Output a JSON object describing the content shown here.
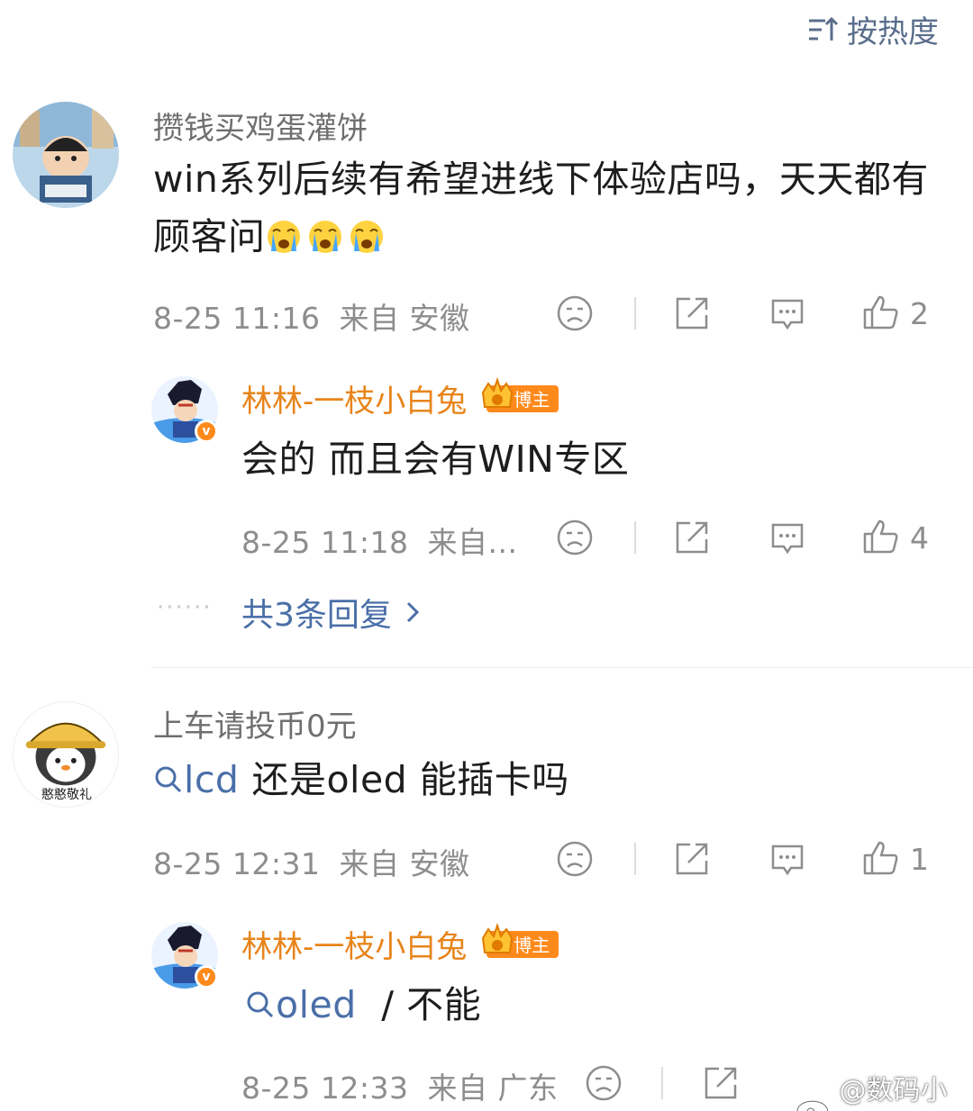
{
  "sort": {
    "label": "按热度",
    "icon": "sort-icon"
  },
  "comments": [
    {
      "username": "攒钱买鸡蛋灌饼",
      "content": "win系列后续有希望进线下体验店吗，天天都有顾客问",
      "emoji_icon": "crying-face-emoji",
      "timestamp": "8-25 11:16",
      "location": "来自 安徽",
      "likes": "2"
    },
    {
      "username": "林林-一枝小白兔",
      "badge": "博主",
      "content": "会的 而且会有WIN专区",
      "timestamp": "8-25 11:18",
      "location": "来自...",
      "likes": "4",
      "more_replies": "共3条回复"
    },
    {
      "username": "上车请投币0元",
      "avatar_text": "憨憨敬礼",
      "content_tag": "lcd",
      "content": "还是oled 能插卡吗",
      "timestamp": "8-25 12:31",
      "location": "来自 安徽",
      "likes": "1"
    },
    {
      "username": "林林-一枝小白兔",
      "badge": "博主",
      "content_tag": "oled",
      "content": " / 不能",
      "timestamp": "8-25 12:33",
      "location": "来自 广东"
    }
  ],
  "watermark": "@数码小樱",
  "colors": {
    "blogger_name": "#e8841a",
    "link": "#4a6fa8",
    "badge_bg": "#ff8a1c",
    "meta": "#8d8d8d"
  }
}
